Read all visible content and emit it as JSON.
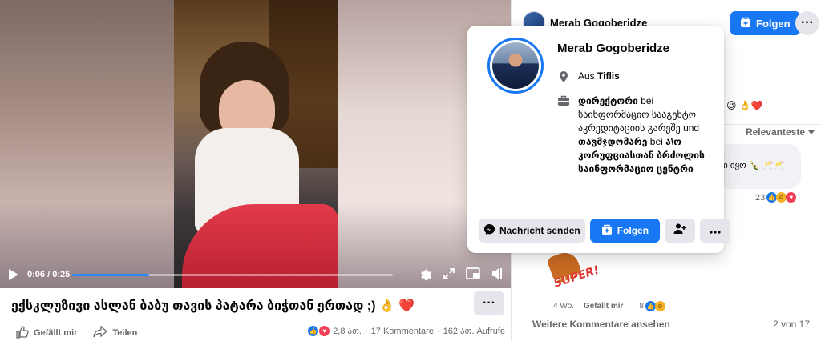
{
  "video": {
    "current_time": "0:06",
    "separator": " / ",
    "duration": "0:25",
    "progress_fraction": 0.24
  },
  "post": {
    "title": "ექსკლუზივი ასლან ბაბუ თავის პატარა ბიჭთან ერთად ;) 👌 ❤️",
    "more_label": "···",
    "like_label": "Gefällt mir",
    "share_label": "Teilen",
    "reactions_count": "2,8 ათ.",
    "comments_count": "17 Kommentare",
    "views_count": "162 ათ. Aufrufe",
    "dot": "·"
  },
  "author": {
    "name": "Merab Gogoberidze",
    "follow_label": "Folgen",
    "more_label": "···"
  },
  "comments": {
    "emoji_line": "😉 👌❤️",
    "sort_label": "Relevanteste",
    "bubble_text": "ი იყო 🍾 🥂🥂",
    "bubble_reactions_count": "23",
    "sticker_text": "SUPER!",
    "meta_time": "4 Wo.",
    "meta_like": "Gefällt mir",
    "meta_reactions_count": "8",
    "view_more": "Weitere Kommentare ansehen",
    "pager": "2 von 17"
  },
  "card": {
    "name": "Merab Gogoberidze",
    "location_prefix": "Aus ",
    "location": "Tiflis",
    "job_role1": "დირექტორი",
    "job_text1": " bei საინფორმაციო სააგენტო აკრედიტაციის გარეშე",
    "job_and": " und ",
    "job_role2": "თავმჯდომარე",
    "job_text2": " bei ",
    "job_org2": "ა\\ო კორუფციასთან ბრძოლის საინფორმაციო ცენტრი",
    "message_label": "Nachricht senden",
    "follow_label": "Folgen"
  },
  "colors": {
    "accent": "#1877f2",
    "secondary_button": "#e4e6eb",
    "muted_text": "#65676b"
  }
}
